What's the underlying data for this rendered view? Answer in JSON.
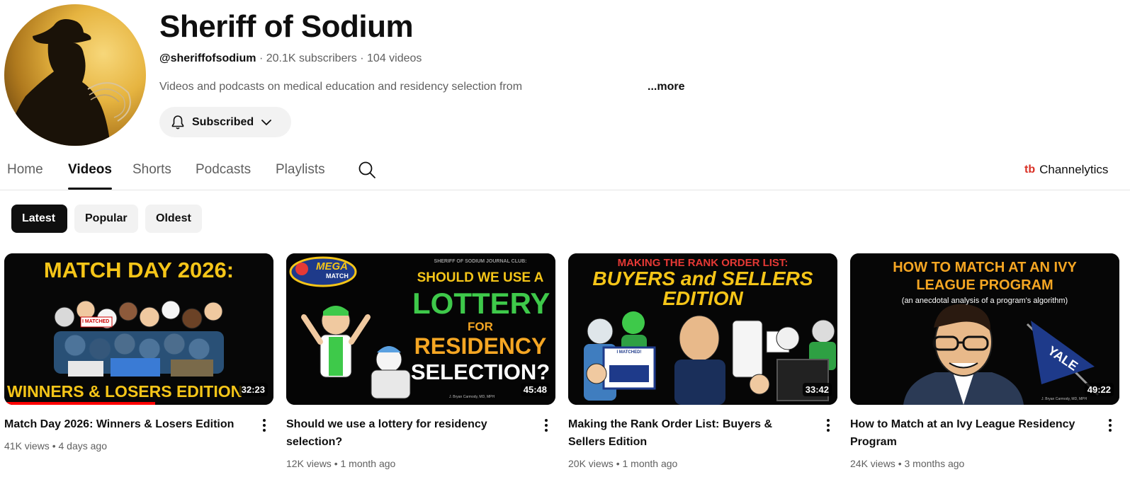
{
  "channel": {
    "name": "Sheriff of Sodium",
    "handle": "@sheriffofsodium",
    "subscribers": "20.1K subscribers",
    "videos": "104 videos",
    "separator": "·",
    "description": "Videos and podcasts on medical education and residency selection from",
    "more_label": "...more",
    "subscribe_label": "Subscribed"
  },
  "tabs": [
    {
      "label": "Home",
      "active": false
    },
    {
      "label": "Videos",
      "active": true
    },
    {
      "label": "Shorts",
      "active": false
    },
    {
      "label": "Podcasts",
      "active": false
    },
    {
      "label": "Playlists",
      "active": false
    }
  ],
  "extension": {
    "logo": "tb",
    "label": "Channelytics"
  },
  "chips": [
    {
      "label": "Latest",
      "selected": true
    },
    {
      "label": "Popular",
      "selected": false
    },
    {
      "label": "Oldest",
      "selected": false
    }
  ],
  "videos": [
    {
      "title": "Match Day 2026: Winners & Losers Edition",
      "views": "41K views",
      "age": "4 days ago",
      "duration": "32:23",
      "watched_fraction": 0.56,
      "thumb_text": [
        "MATCH DAY 2026:",
        "WINNERS & LOSERS EDITION",
        "I MATCHED"
      ]
    },
    {
      "title": "Should we use a lottery for residency selection?",
      "views": "12K views",
      "age": "1 month ago",
      "duration": "45:48",
      "thumb_text": [
        "SHERIFF OF SODIUM JOURNAL CLUB:",
        "SHOULD WE USE A",
        "LOTTERY",
        "FOR",
        "RESIDENCY",
        "SELECTION?",
        "MEGA",
        "MATCH",
        "J. Bryan Carmody, MD, MPH"
      ]
    },
    {
      "title": "Making the Rank Order List: Buyers & Sellers Edition",
      "views": "20K views",
      "age": "1 month ago",
      "duration": "33:42",
      "thumb_text": [
        "MAKING THE RANK ORDER LIST:",
        "BUYERS and SELLERS",
        "EDITION",
        "I MATCHED!"
      ]
    },
    {
      "title": "How to Match at an Ivy League Residency Program",
      "views": "24K views",
      "age": "3 months ago",
      "duration": "49:22",
      "thumb_text": [
        "HOW TO MATCH AT AN IVY",
        "LEAGUE PROGRAM",
        "(an anecdotal analysis of a program's algorithm)",
        "YALE",
        "J. Bryan Carmody, MD, MPH"
      ]
    }
  ],
  "colors": {
    "accent_red": "#ff0000",
    "thumb_yellow": "#f5c518",
    "thumb_green": "#3ec94a",
    "thumb_orange": "#f5a623",
    "thumb_red": "#e53935"
  }
}
